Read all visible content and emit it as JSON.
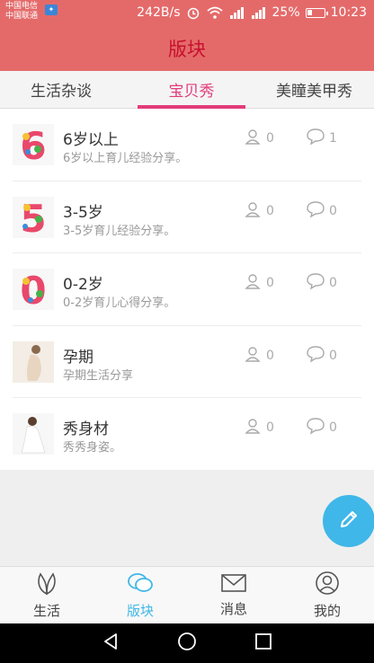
{
  "status": {
    "carrier1": "中国电信",
    "carrier2": "中国联通",
    "speed": "242B/s",
    "battery": "25%",
    "time": "10:23"
  },
  "header": {
    "title": "版块"
  },
  "tabs": [
    {
      "label": "生活杂谈"
    },
    {
      "label": "宝贝秀"
    },
    {
      "label": "美瞳美甲秀"
    }
  ],
  "list": [
    {
      "title": "6岁以上",
      "subtitle": "6岁以上育儿经验分享。",
      "users": "0",
      "comments": "1"
    },
    {
      "title": "3-5岁",
      "subtitle": "3-5岁育儿经验分享。",
      "users": "0",
      "comments": "0"
    },
    {
      "title": "0-2岁",
      "subtitle": "0-2岁育儿心得分享。",
      "users": "0",
      "comments": "0"
    },
    {
      "title": "孕期",
      "subtitle": "孕期生活分享",
      "users": "0",
      "comments": "0"
    },
    {
      "title": "秀身材",
      "subtitle": "秀秀身姿。",
      "users": "0",
      "comments": "0"
    }
  ],
  "bottom_nav": [
    {
      "label": "生活",
      "icon": "leaf-icon"
    },
    {
      "label": "版块",
      "icon": "chat-bubbles-icon"
    },
    {
      "label": "消息",
      "icon": "mail-icon"
    },
    {
      "label": "我的",
      "icon": "user-icon"
    }
  ],
  "colors": {
    "primary": "#e46a6a",
    "title": "#c8102e",
    "accent_tab": "#e23c7a",
    "accent_blue": "#3fb7e8"
  }
}
